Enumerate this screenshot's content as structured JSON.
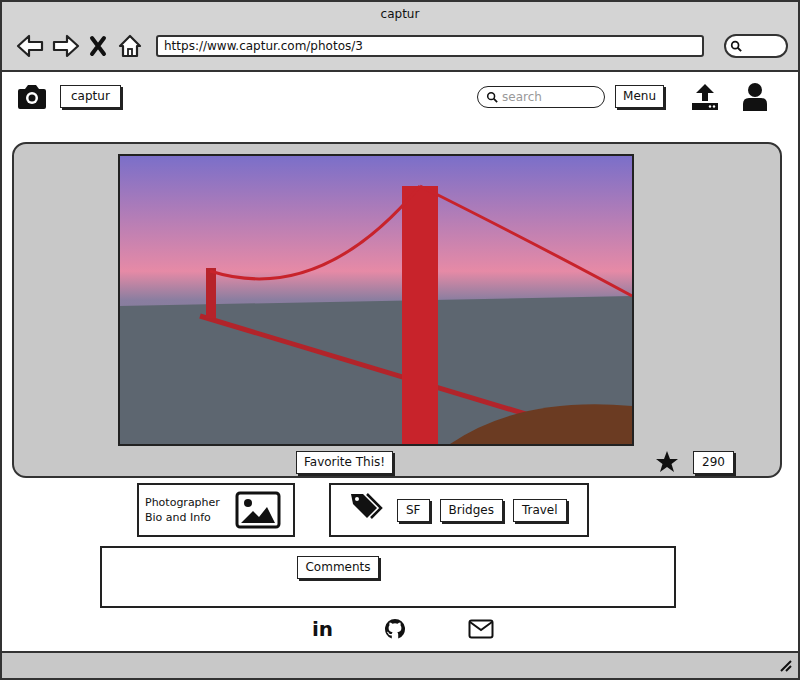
{
  "window": {
    "title": "captur",
    "url": "https://www.captur.com/photos/3"
  },
  "header": {
    "logo": "captur",
    "search_placeholder": "search",
    "menu": "Menu"
  },
  "photo": {
    "favorite_button": "Favorite This!",
    "favorites": "290"
  },
  "photographer": {
    "label": "Photographer Bio and Info"
  },
  "tags": [
    {
      "label": "SF"
    },
    {
      "label": "Bridges"
    },
    {
      "label": "Travel"
    }
  ],
  "comments": {
    "label": "Comments"
  },
  "footer": {
    "linkedin": "in"
  }
}
